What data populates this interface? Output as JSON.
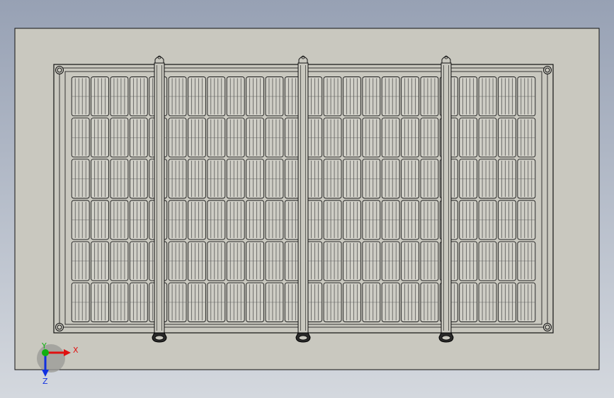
{
  "viewport": {
    "background_top": "#97a1b4",
    "background_bottom": "#d4d8de",
    "sheet_color": "#c9c8bf",
    "line_color": "#111111"
  },
  "panel": {
    "cell_columns": 24,
    "cell_rows": 6,
    "frame_color": "#c9c8bf",
    "cell_line_color": "#1a1a1a"
  },
  "rails": {
    "count": 3,
    "foot_icon": "clamp-foot-icon",
    "cap_icon": "end-cap-icon"
  },
  "mount_holes": {
    "count": 4
  },
  "triad": {
    "x_label": "X",
    "y_label": "Y",
    "z_label": "Z",
    "x_color": "#e01010",
    "y_color": "#10b010",
    "z_color": "#1030e0"
  }
}
